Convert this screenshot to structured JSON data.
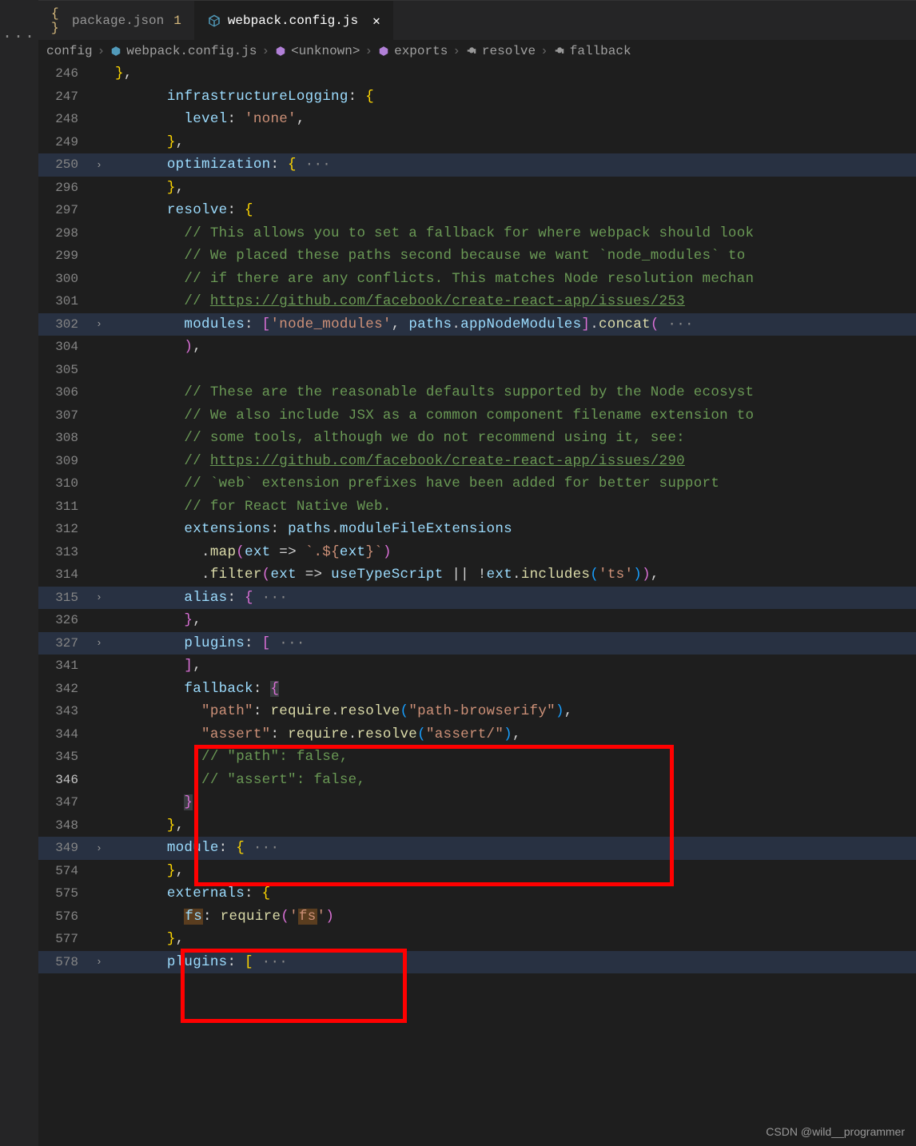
{
  "activity": {
    "dots": "···"
  },
  "tabs": {
    "0": {
      "label": "package.json",
      "modified": "1"
    },
    "1": {
      "label": "webpack.config.js"
    }
  },
  "breadcrumbs": {
    "0": "config",
    "1": "webpack.config.js",
    "2": "<unknown>",
    "3": "exports",
    "4": "resolve",
    "5": "fallback"
  },
  "lines": {
    "246": {
      "no": "246",
      "c": "      },",
      "type": "punct"
    },
    "247": {
      "no": "247"
    },
    "248": {
      "no": "248"
    },
    "249": {
      "no": "249",
      "c": "      },",
      "type": "punct"
    },
    "250": {
      "no": "250"
    },
    "296": {
      "no": "296",
      "c": "      },",
      "type": "punct"
    },
    "297": {
      "no": "297"
    },
    "298": {
      "no": "298",
      "c": "// This allows you to set a fallback for where webpack should look"
    },
    "299": {
      "no": "299",
      "c": "// We placed these paths second because we want `node_modules` to "
    },
    "300": {
      "no": "300",
      "c": "// if there are any conflicts. This matches Node resolution mechan"
    },
    "301": {
      "no": "301",
      "pre": "// ",
      "link": "https://github.com/facebook/create-react-app/issues/253"
    },
    "302": {
      "no": "302"
    },
    "304": {
      "no": "304",
      "c": "),",
      "type": "punct"
    },
    "305": {
      "no": "305",
      "c": "",
      "type": "punct"
    },
    "306": {
      "no": "306",
      "c": "// These are the reasonable defaults supported by the Node ecosyst"
    },
    "307": {
      "no": "307",
      "c": "// We also include JSX as a common component filename extension to"
    },
    "308": {
      "no": "308",
      "c": "// some tools, although we do not recommend using it, see:"
    },
    "309": {
      "no": "309",
      "pre": "// ",
      "link": "https://github.com/facebook/create-react-app/issues/290"
    },
    "310": {
      "no": "310",
      "c": "// `web` extension prefixes have been added for better support"
    },
    "311": {
      "no": "311",
      "c": "// for React Native Web."
    },
    "312": {
      "no": "312"
    },
    "313": {
      "no": "313"
    },
    "314": {
      "no": "314"
    },
    "315": {
      "no": "315"
    },
    "326": {
      "no": "326",
      "c": "      },",
      "type": "punct"
    },
    "327": {
      "no": "327"
    },
    "341": {
      "no": "341",
      "c": "      ],",
      "type": "punct"
    },
    "342": {
      "no": "342"
    },
    "343": {
      "no": "343"
    },
    "344": {
      "no": "344"
    },
    "345": {
      "no": "345",
      "c": "// \"path\": false,"
    },
    "346": {
      "no": "346",
      "c": "// \"assert\": false,"
    },
    "347": {
      "no": "347"
    },
    "348": {
      "no": "348",
      "c": "    },",
      "type": "punct"
    },
    "349": {
      "no": "349"
    },
    "574": {
      "no": "574",
      "c": "    },",
      "type": "punct"
    },
    "575": {
      "no": "575"
    },
    "576": {
      "no": "576"
    },
    "577": {
      "no": "577",
      "c": "    },",
      "type": "punct"
    },
    "578": {
      "no": "578"
    }
  },
  "watermark": "CSDN @wild__programmer"
}
